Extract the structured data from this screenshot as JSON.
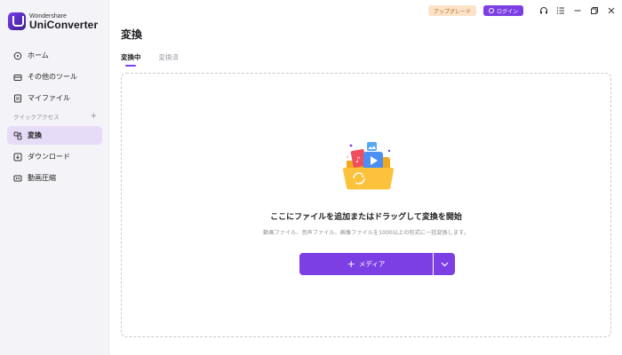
{
  "app": {
    "brand": "Wondershare",
    "product": "UniConverter"
  },
  "topbar": {
    "upgrade_label": "アップグレード",
    "login_label": "ログイン"
  },
  "sidebar": {
    "items": [
      {
        "label": "ホーム",
        "icon": "home-icon"
      },
      {
        "label": "その他のツール",
        "icon": "toolbox-icon"
      },
      {
        "label": "マイファイル",
        "icon": "file-icon"
      }
    ],
    "section_label": "クイックアクセス",
    "quick_items": [
      {
        "label": "変換",
        "icon": "convert-icon",
        "active": true
      },
      {
        "label": "ダウンロード",
        "icon": "download-icon"
      },
      {
        "label": "動画圧縮",
        "icon": "compress-icon"
      }
    ]
  },
  "main": {
    "title": "変換",
    "tabs": [
      {
        "label": "変換中",
        "active": true
      },
      {
        "label": "変換済",
        "active": false
      }
    ],
    "dropzone": {
      "title": "ここにファイルを追加またはドラッグして変換を開始",
      "subtitle": "動画ファイル、音声ファイル、画像ファイルを1000以上の形式に一括変換します。",
      "button_label": "メディア"
    }
  },
  "colors": {
    "accent": "#7b3fe4",
    "sidebar_bg": "#f4f4f8",
    "active_item_bg": "#e6dcf7",
    "upgrade_bg": "#fbe2c8"
  }
}
